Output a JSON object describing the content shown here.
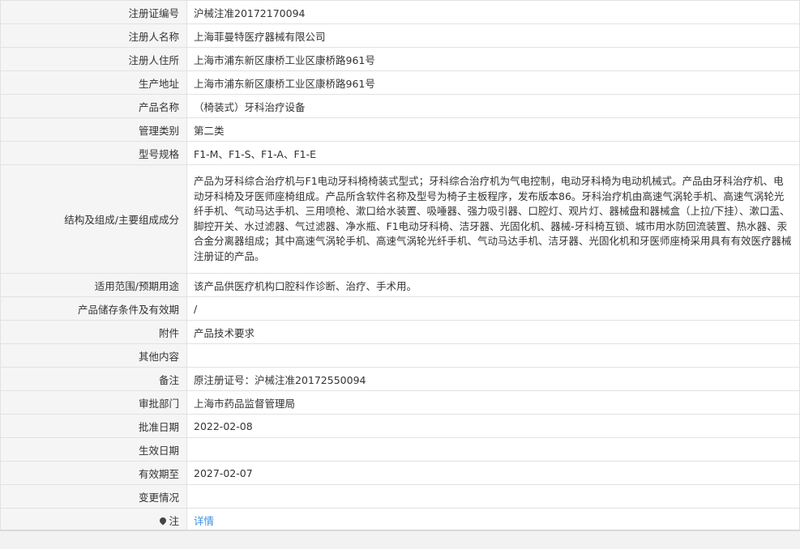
{
  "rows": [
    {
      "label": "注册证编号",
      "value": "沪械注准20172170094"
    },
    {
      "label": "注册人名称",
      "value": "上海菲曼特医疗器械有限公司"
    },
    {
      "label": "注册人住所",
      "value": "上海市浦东新区康桥工业区康桥路961号"
    },
    {
      "label": "生产地址",
      "value": "上海市浦东新区康桥工业区康桥路961号"
    },
    {
      "label": "产品名称",
      "value": "（椅装式）牙科治疗设备"
    },
    {
      "label": "管理类别",
      "value": "第二类"
    },
    {
      "label": "型号规格",
      "value": "F1-M、F1-S、F1-A、F1-E"
    },
    {
      "label": "结构及组成/主要组成成分",
      "value": "产品为牙科综合治疗机与F1电动牙科椅椅装式型式；牙科综合治疗机为气电控制，电动牙科椅为电动机械式。产品由牙科治疗机、电动牙科椅及牙医师座椅组成。产品所含软件名称及型号为椅子主板程序，发布版本86。牙科治疗机由高速气涡轮手机、高速气涡轮光纤手机、气动马达手机、三用喷枪、漱口给水装置、吸唾器、强力吸引器、口腔灯、观片灯、器械盘和器械盒（上拉/下挂）、漱口盂、脚控开关、水过滤器、气过滤器、净水瓶、F1电动牙科椅、洁牙器、光固化机、器械-牙科椅互锁、城市用水防回流装置、热水器、汞合金分离器组成；其中高速气涡轮手机、高速气涡轮光纤手机、气动马达手机、洁牙器、光固化机和牙医师座椅采用具有有效医疗器械注册证的产品。"
    },
    {
      "label": "适用范围/预期用途",
      "value": "该产品供医疗机构口腔科作诊断、治疗、手术用。"
    },
    {
      "label": "产品储存条件及有效期",
      "value": "/"
    },
    {
      "label": "附件",
      "value": "产品技术要求"
    },
    {
      "label": "其他内容",
      "value": ""
    },
    {
      "label": "备注",
      "value": "原注册证号：沪械注准20172550094"
    },
    {
      "label": "审批部门",
      "value": "上海市药品监督管理局"
    },
    {
      "label": "批准日期",
      "value": "2022-02-08"
    },
    {
      "label": "生效日期",
      "value": ""
    },
    {
      "label": "有效期至",
      "value": "2027-02-07"
    },
    {
      "label": "变更情况",
      "value": ""
    }
  ],
  "note": {
    "label": "注",
    "icon": "map-pin-icon",
    "link": "详情",
    "link_color": "#3a8ee6"
  }
}
